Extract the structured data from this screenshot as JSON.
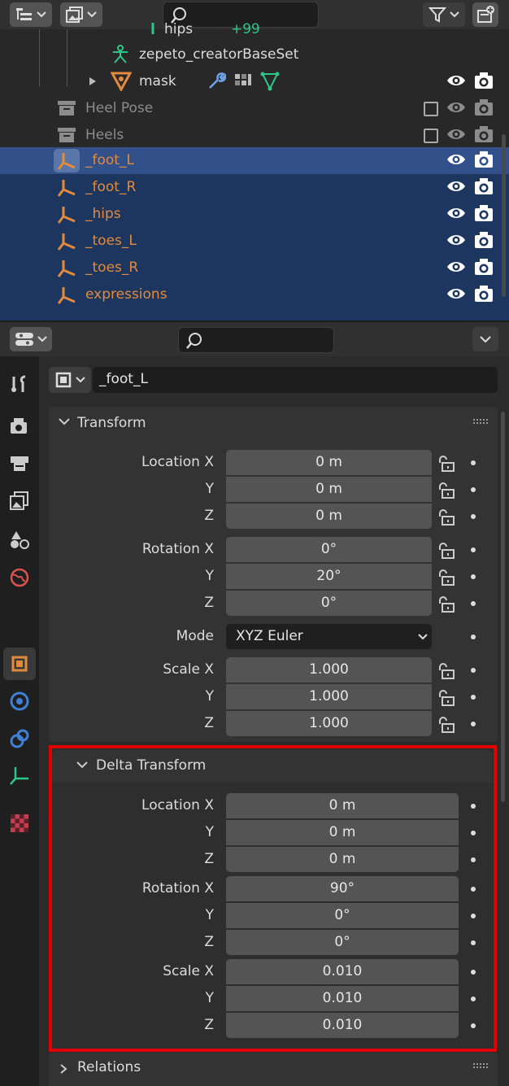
{
  "outliner": {
    "rows": [
      {
        "label": "hips",
        "extra": "+99"
      },
      {
        "label": "zepeto_creatorBaseSet"
      },
      {
        "label": "mask"
      },
      {
        "label": "Heel Pose"
      },
      {
        "label": "Heels"
      },
      {
        "label": "_foot_L"
      },
      {
        "label": "_foot_R"
      },
      {
        "label": "_hips"
      },
      {
        "label": "_toes_L"
      },
      {
        "label": "_toes_R"
      },
      {
        "label": "expressions"
      }
    ]
  },
  "properties": {
    "object_name": "_foot_L",
    "transform": {
      "title": "Transform",
      "location_label": "Location X",
      "rotation_label": "Rotation X",
      "scale_label": "Scale X",
      "mode_label": "Mode",
      "y_label": "Y",
      "z_label": "Z",
      "location": [
        "0 m",
        "0 m",
        "0 m"
      ],
      "rotation": [
        "0°",
        "20°",
        "0°"
      ],
      "mode": "XYZ Euler",
      "scale": [
        "1.000",
        "1.000",
        "1.000"
      ]
    },
    "delta": {
      "title": "Delta Transform",
      "location_label": "Location X",
      "rotation_label": "Rotation X",
      "scale_label": "Scale X",
      "y_label": "Y",
      "z_label": "Z",
      "location": [
        "0 m",
        "0 m",
        "0 m"
      ],
      "rotation": [
        "90°",
        "0°",
        "0°"
      ],
      "scale": [
        "0.010",
        "0.010",
        "0.010"
      ]
    },
    "relations": {
      "title": "Relations"
    }
  },
  "colors": {
    "highlight_box": "#e00000",
    "selected_row": "#1c365f",
    "active_row": "#32508a",
    "object_text": "#e38a3c"
  }
}
